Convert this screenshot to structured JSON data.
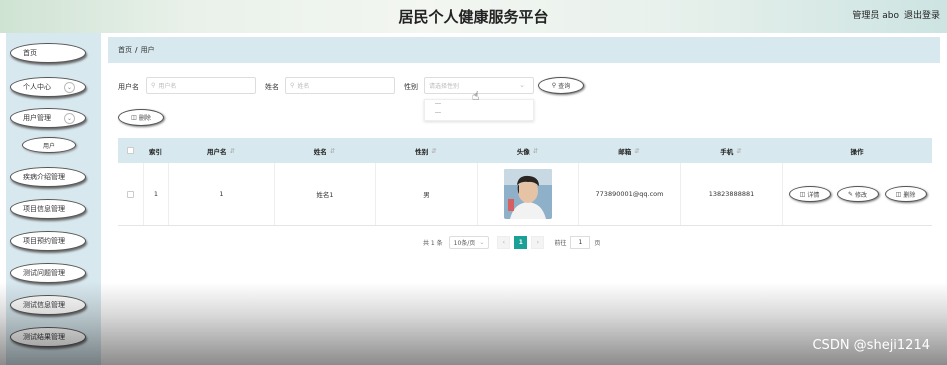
{
  "header": {
    "title": "居民个人健康服务平台",
    "user_label": "管理员 abo",
    "logout_label": "退出登录"
  },
  "sidebar": {
    "items": [
      {
        "label": "首页"
      },
      {
        "label": "个人中心"
      },
      {
        "label": "用户管理"
      },
      {
        "label": "用户"
      },
      {
        "label": "疾病介绍管理"
      },
      {
        "label": "项目信息管理"
      },
      {
        "label": "项目预约管理"
      },
      {
        "label": "测试问题管理"
      },
      {
        "label": "测试信息管理"
      },
      {
        "label": "测试结果管理"
      }
    ]
  },
  "breadcrumb": {
    "home": "首页",
    "sep": "/",
    "current": "用户"
  },
  "search": {
    "username_label": "用户名",
    "username_placeholder": "用户名",
    "name_label": "姓名",
    "name_placeholder": "姓名",
    "gender_label": "性别",
    "gender_placeholder": "请选择性别",
    "query_label": "查询",
    "delete_label": "删除"
  },
  "table": {
    "headers": [
      "索引",
      "用户名",
      "姓名",
      "性别",
      "头像",
      "邮箱",
      "手机",
      "操作"
    ],
    "rows": [
      {
        "index": "1",
        "username": "1",
        "name": "姓名1",
        "gender": "男",
        "email": "773890001@qq.com",
        "phone": "13823888881",
        "detail": "详情",
        "edit": "修改",
        "delete": "删除"
      }
    ]
  },
  "pagination": {
    "total": "共 1 条",
    "page_size": "10条/页",
    "current_page": "1",
    "goto_label": "前往",
    "goto_value": "1",
    "page_unit": "页"
  },
  "watermark": "CSDN @sheji1214",
  "colors": {
    "accent": "#1aa094",
    "panel": "#d7e8ee"
  }
}
